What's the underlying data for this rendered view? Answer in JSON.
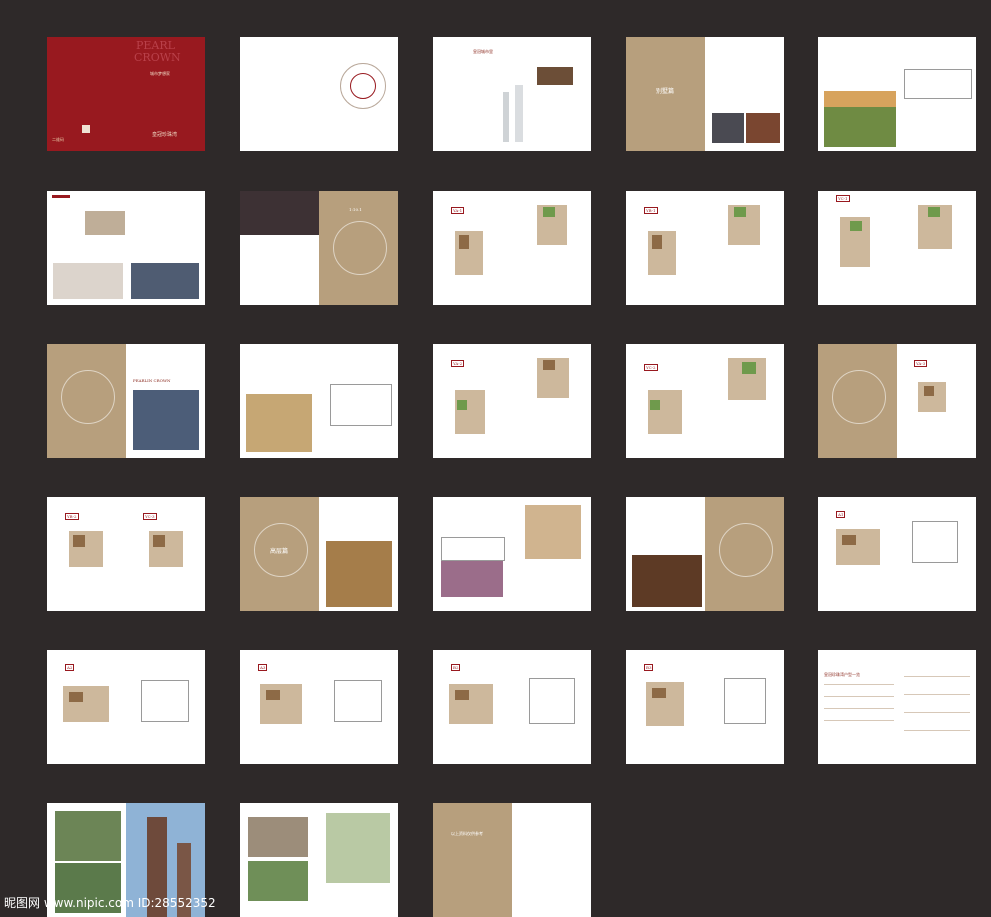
{
  "watermark": "昵图网 www.nipic.com  ID:28552352",
  "cover": {
    "brand_en_line1": "PEARL",
    "brand_en_line2": "CROWN",
    "brand_cn": "皇冠珍珠湾",
    "tagline": "城市梦想家",
    "code_label": "二维码"
  },
  "sections": {
    "villa_chapter": "别墅篇",
    "high_rise_chapter": "高层篇",
    "scale_label": "1:10.1"
  },
  "pearl_crown_header": "PEARLIN CROWN",
  "unit_tags": [
    "YA-1",
    "YB-1",
    "YC-1",
    "YA-2",
    "YC-2",
    "YA-3",
    "YB-2",
    "YC-3",
    "A1",
    "A2",
    "A3",
    "B2",
    "B3"
  ],
  "table_title": "皇冠珍珠湾户型一览",
  "last_page_note": "以上资料仅供参考"
}
